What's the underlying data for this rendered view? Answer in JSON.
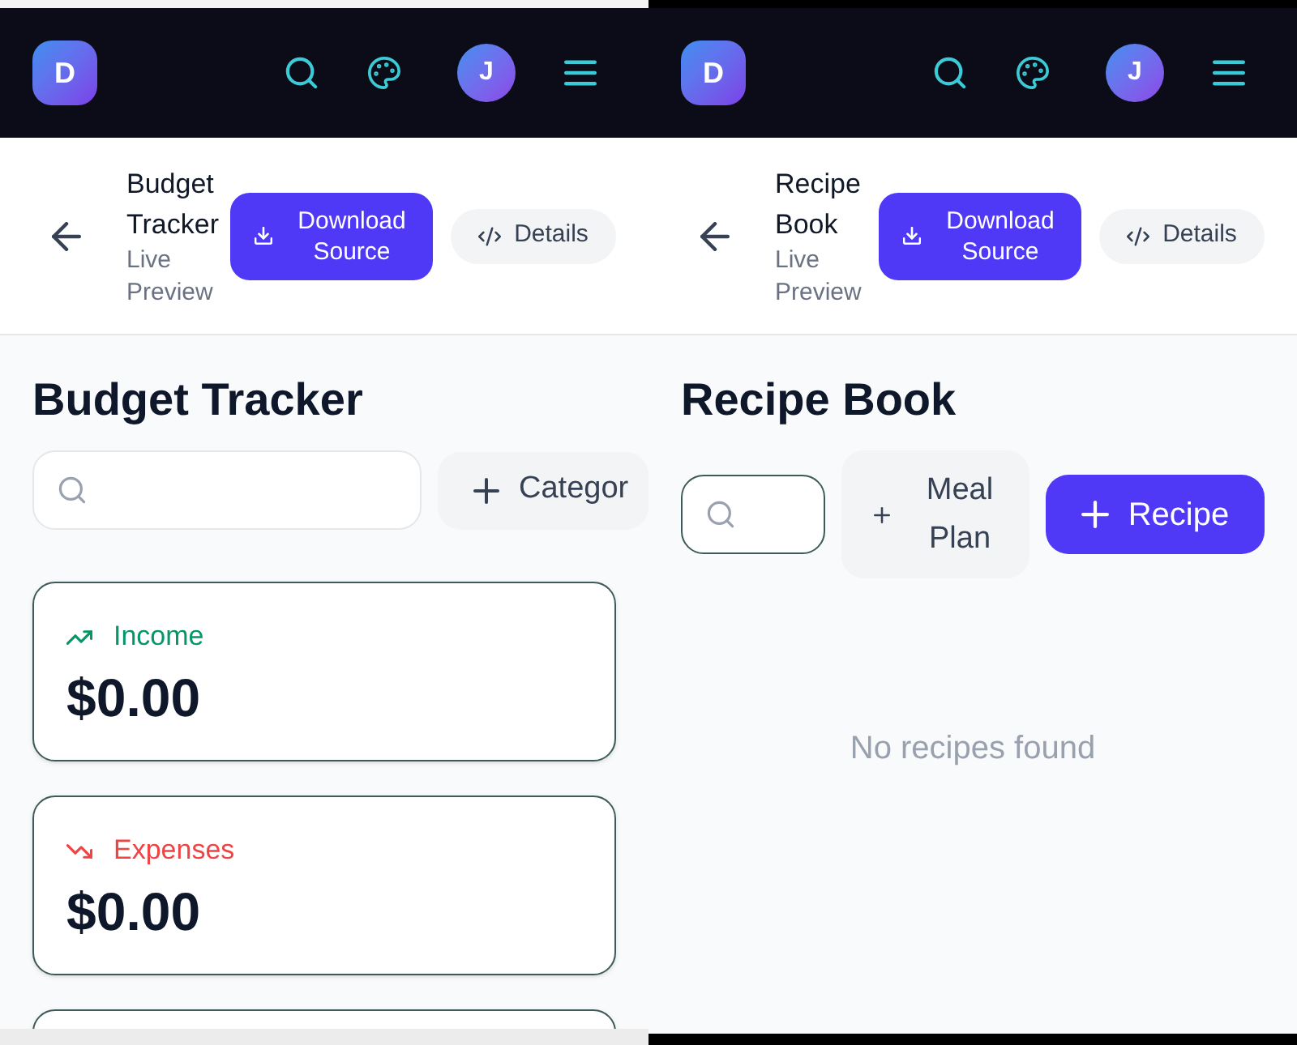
{
  "screens": [
    {
      "dark_edges": false,
      "navbar": {
        "logo": "D",
        "avatar": "J"
      },
      "header": {
        "title": "Budget Tracker",
        "subtitle": "Live Preview",
        "download_button": "Download Source",
        "details_button": "Details"
      },
      "page_title": "Budget Tracker",
      "toolbar": [
        {
          "kind": "search",
          "focused": false
        },
        {
          "kind": "secondary",
          "label": "Categor"
        }
      ],
      "cards": [
        {
          "kind": "income",
          "label": "Income",
          "amount": "$0.00",
          "color": "#059669"
        },
        {
          "kind": "expense",
          "label": "Expenses",
          "amount": "$0.00",
          "color": "#ef4444"
        },
        {
          "kind": "partial"
        }
      ]
    },
    {
      "dark_edges": true,
      "navbar": {
        "logo": "D",
        "avatar": "J"
      },
      "header": {
        "title": "Recipe Book",
        "subtitle": "Live Preview",
        "download_button": "Download Source",
        "details_button": "Details"
      },
      "page_title": "Recipe Book",
      "toolbar": [
        {
          "kind": "search",
          "focused": true
        },
        {
          "kind": "secondary",
          "label": "Meal Plan"
        },
        {
          "kind": "primary",
          "label": "Recipe"
        }
      ],
      "empty_message": "No recipes found"
    }
  ]
}
